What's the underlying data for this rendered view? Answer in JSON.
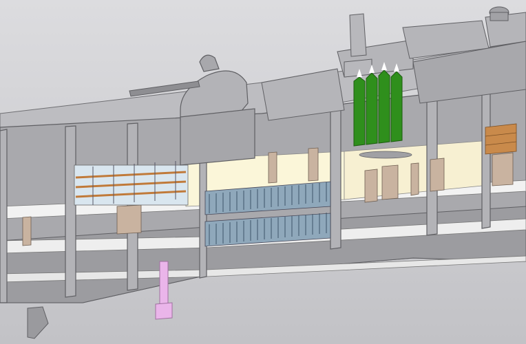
{
  "viewport": {
    "background_colors": {
      "sky_top": "#d9d9dc",
      "sky_bottom": "#c4c4c8",
      "hull_gray": "#a9a9ad",
      "hull_dark": "#8f8f93",
      "deck_white": "#f2f2f2",
      "interior_cream": "#fbf6d9",
      "bulkhead_tan": "#c9b3a0",
      "missile_green": "#2f8f1c",
      "cell_blue": "#7f9fb5",
      "pink_shaft": "#eab5ea",
      "crate_orange": "#c98a4b"
    },
    "parts": [
      "hull-section",
      "upper-deck",
      "main-gun-turret",
      "gun-barrel",
      "superstructure",
      "radar-mast",
      "missile-rack",
      "shell-storage-upper",
      "shell-storage-lower",
      "ammo-shelves",
      "crate-stack",
      "propeller-shaft",
      "keel-fin"
    ]
  }
}
